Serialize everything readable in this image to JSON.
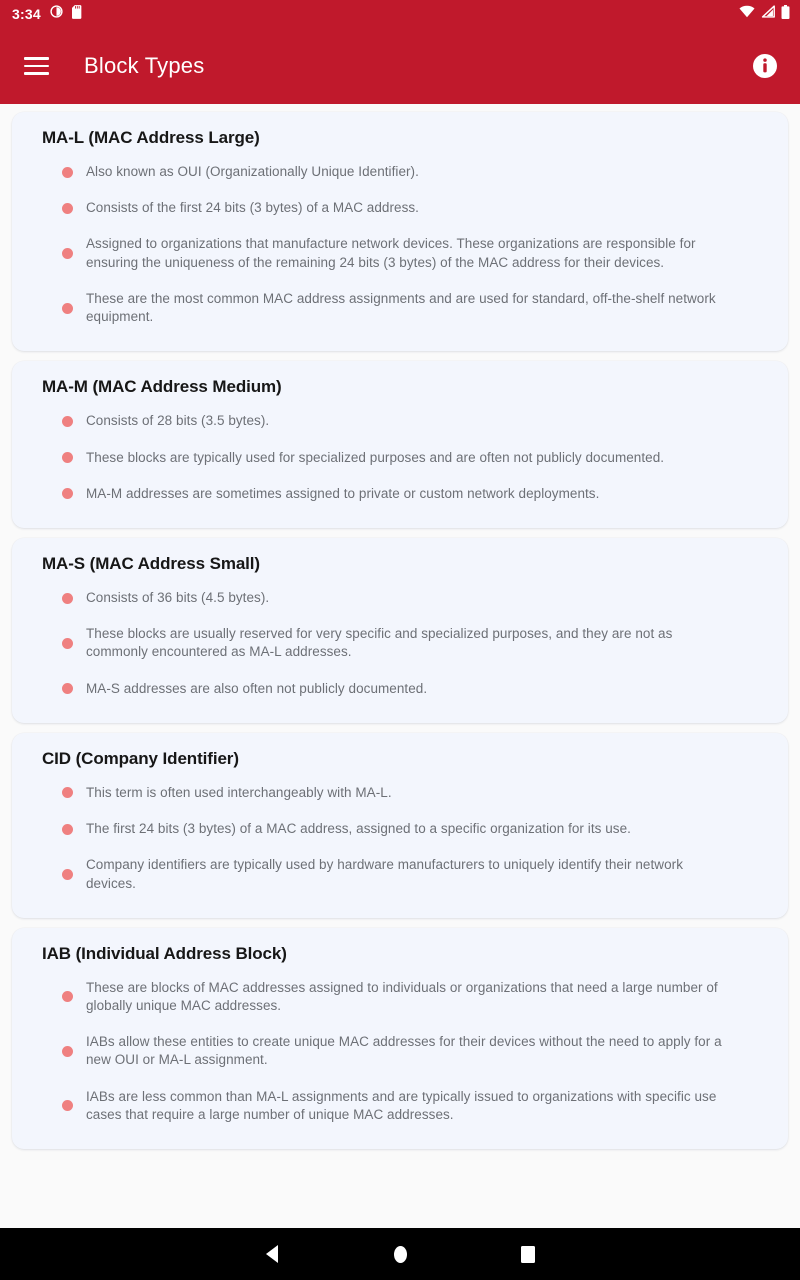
{
  "status_bar": {
    "time": "3:34",
    "icons_left": [
      "do-not-disturb-icon",
      "sd-card-icon"
    ],
    "icons_right": [
      "wifi-icon",
      "cellular-signal-icon",
      "battery-icon"
    ]
  },
  "app_bar": {
    "title": "Block Types",
    "menu_icon": "hamburger-menu-icon",
    "info_icon": "info-icon"
  },
  "theme": {
    "primary": "#c0192c",
    "card_bg": "#f3f6fd",
    "page_bg": "#fafafa",
    "bullet_color": "#ef8080",
    "body_text": "#6d7076",
    "title_text": "#171717"
  },
  "cards": [
    {
      "title": "MA-L (MAC Address Large)",
      "bullets": [
        "Also known as OUI (Organizationally Unique Identifier).",
        "Consists of the first 24 bits (3 bytes) of a MAC address.",
        "Assigned to organizations that manufacture network devices. These organizations are responsible for ensuring the uniqueness of the remaining 24 bits (3 bytes) of the MAC address for their devices.",
        "These are the most common MAC address assignments and are used for standard, off-the-shelf network equipment."
      ]
    },
    {
      "title": "MA-M (MAC Address Medium)",
      "bullets": [
        "Consists of 28 bits (3.5 bytes).",
        "These blocks are typically used for specialized purposes and are often not publicly documented.",
        "MA-M addresses are sometimes assigned to private or custom network deployments."
      ]
    },
    {
      "title": "MA-S (MAC Address Small)",
      "bullets": [
        "Consists of 36 bits (4.5 bytes).",
        "These blocks are usually reserved for very specific and specialized purposes, and they are not as commonly encountered as MA-L addresses.",
        "MA-S addresses are also often not publicly documented."
      ]
    },
    {
      "title": "CID (Company Identifier)",
      "bullets": [
        "This term is often used interchangeably with MA-L.",
        "The first 24 bits (3 bytes) of a MAC address, assigned to a specific organization for its use.",
        "Company identifiers are typically used by hardware manufacturers to uniquely identify their network devices."
      ]
    },
    {
      "title": "IAB (Individual Address Block)",
      "bullets": [
        "These are blocks of MAC addresses assigned to individuals or organizations that need a large number of globally unique MAC addresses.",
        "IABs allow these entities to create unique MAC addresses for their devices without the need to apply for a new OUI or MA-L assignment.",
        "IABs are less common than MA-L assignments and are typically issued to organizations with specific use cases that require a large number of unique MAC addresses."
      ]
    }
  ],
  "nav_bar": {
    "back_label": "Back",
    "home_label": "Home",
    "recents_label": "Recents"
  }
}
